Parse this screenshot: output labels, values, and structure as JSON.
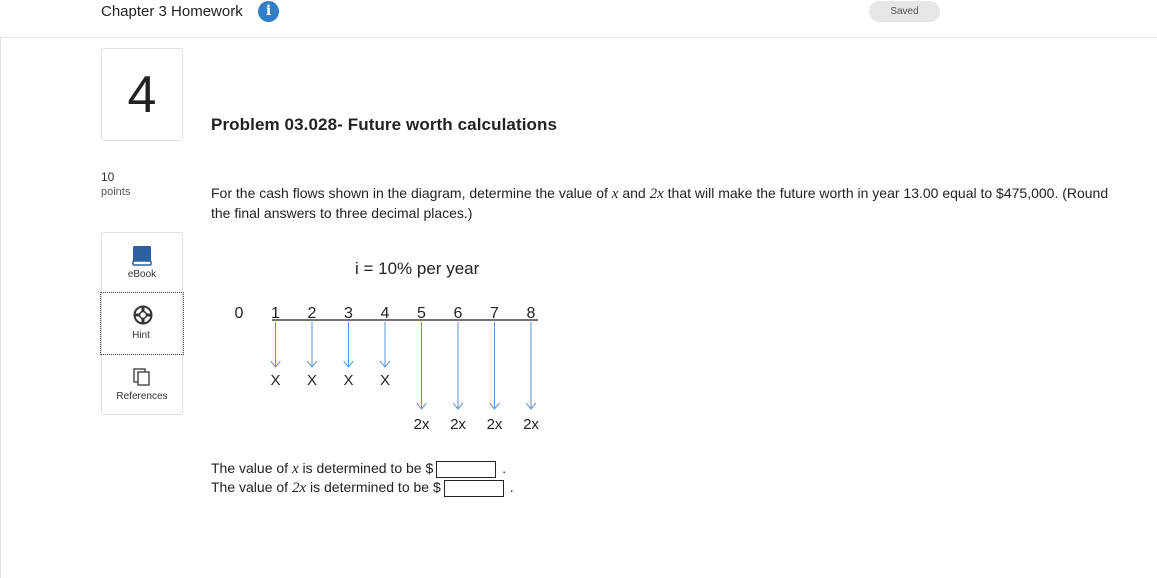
{
  "header": {
    "title": "Chapter 3 Homework",
    "info_icon": "i",
    "saved_label": "Saved"
  },
  "question": {
    "number": "4",
    "points_value": "10",
    "points_label": "points"
  },
  "tools": {
    "ebook_label": "eBook",
    "hint_label": "Hint",
    "references_label": "References"
  },
  "problem": {
    "title": "Problem 03.028- Future worth calculations",
    "text_1": "For the cash flows shown in the diagram, determine the value of ",
    "var_x": "x",
    "text_2": " and ",
    "var_2x": "2x",
    "text_3": " that will make the future worth in year 13.00 equal to $475,000. (Round the final answers to three decimal places.)"
  },
  "diagram": {
    "rate_label": "i = 10% per year",
    "years": [
      "0",
      "1",
      "2",
      "3",
      "4",
      "5",
      "6",
      "7",
      "8"
    ],
    "small_flows": [
      "X",
      "X",
      "X",
      "X"
    ],
    "large_flows": [
      "2x",
      "2x",
      "2x",
      "2x"
    ]
  },
  "answers": {
    "x_prefix": "The value of ",
    "x_var": "x",
    "x_suffix": " is determined to be $",
    "x_value": "",
    "two_x_prefix": "The value of ",
    "two_x_var": "2x",
    "two_x_suffix": " is determined to be $",
    "two_x_value": "",
    "period": "."
  },
  "colors": {
    "info_blue": "#2f7ec7",
    "arrow_blue": "#5b8fcf",
    "ebook_blue": "#2e5f9e"
  }
}
